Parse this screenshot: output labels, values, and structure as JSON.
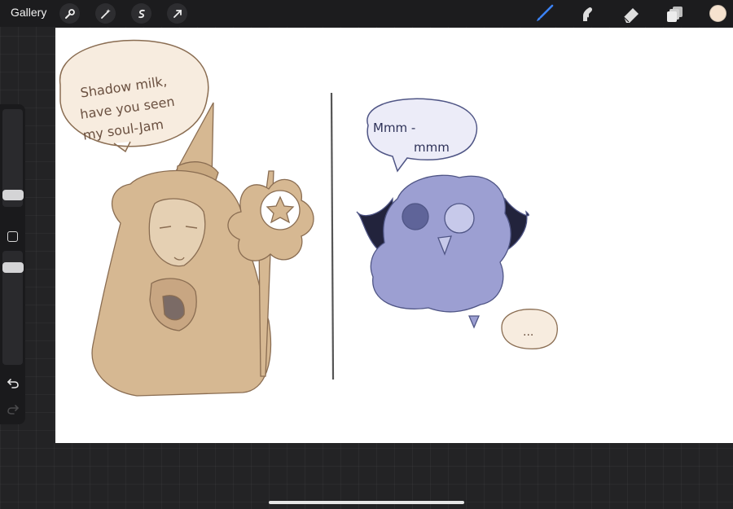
{
  "topbar": {
    "gallery_label": "Gallery",
    "left_tools": [
      "wrench-icon",
      "magic-wand-icon",
      "selection-icon",
      "transform-arrow-icon"
    ],
    "right_tools": [
      "brush-icon",
      "smudge-icon",
      "eraser-icon",
      "layers-icon"
    ],
    "active_tool": "brush",
    "current_color": "#f6e2cf",
    "accent_color": "#3b82f6"
  },
  "sidebar": {
    "brush_size_level": 0.35,
    "opacity_level": 0.68,
    "modify_button": "square-icon",
    "undo": "undo-icon",
    "redo": "redo-icon"
  },
  "artwork": {
    "left_bubble_lines": [
      "Shadow milk,",
      "have you seen",
      "my soul-Jam"
    ],
    "right_bubble_lines": [
      "Mmm -",
      "mmm"
    ],
    "small_bubble": "...",
    "colors": {
      "wizard_fill": "#d6b892",
      "wizard_line": "#8a6d52",
      "creature_fill": "#9c9fd2",
      "creature_line": "#4f5585",
      "horn_dark": "#22233c",
      "bubble_fill": "#f7ecdf",
      "bubble_fill_purple": "#ececf8"
    }
  }
}
